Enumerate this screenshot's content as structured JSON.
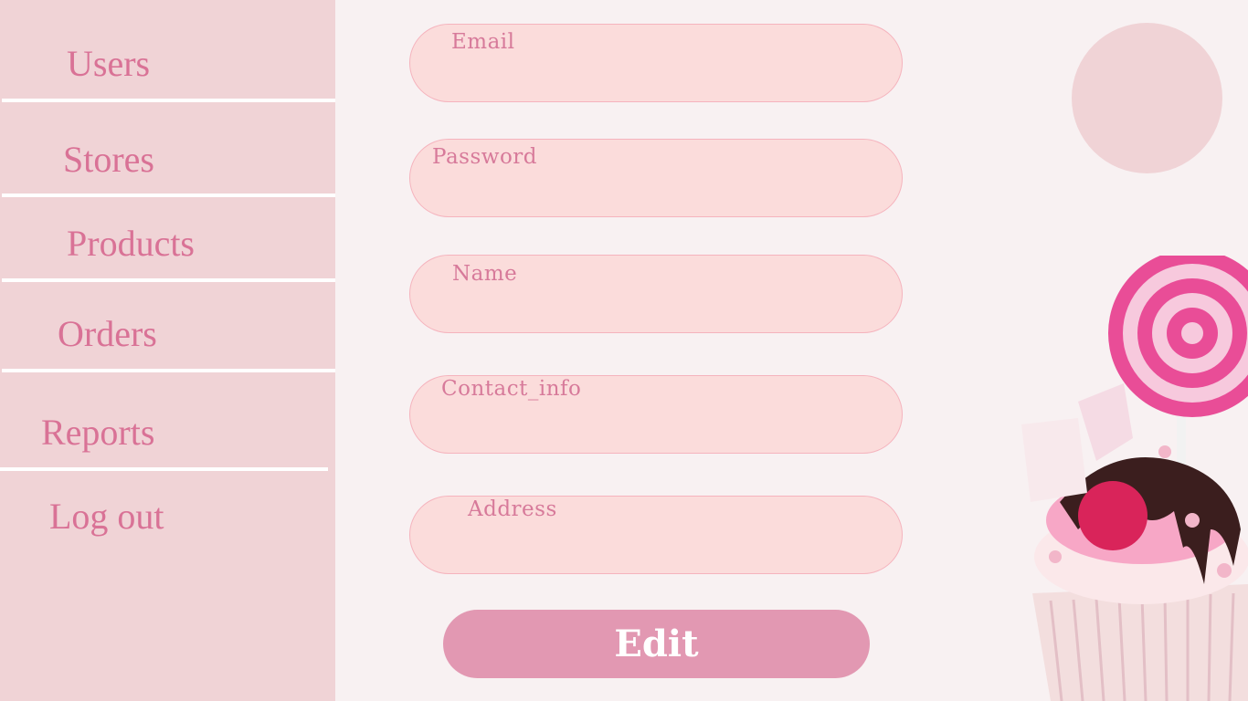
{
  "sidebar": {
    "items": [
      {
        "label": "Users"
      },
      {
        "label": "Stores"
      },
      {
        "label": "Products"
      },
      {
        "label": "Orders"
      },
      {
        "label": "Reports"
      },
      {
        "label": "Log out"
      }
    ]
  },
  "form": {
    "fields": [
      {
        "label": "Email",
        "value": ""
      },
      {
        "label": "Password",
        "value": ""
      },
      {
        "label": "Name",
        "value": ""
      },
      {
        "label": "Contact_info",
        "value": ""
      },
      {
        "label": "Address",
        "value": ""
      }
    ],
    "submit_label": "Edit"
  },
  "colors": {
    "sidebar_bg": "#f0d3d6",
    "nav_text": "#d97296",
    "field_bg": "#fbdcdb",
    "field_border": "#f5b3bd",
    "button_bg": "#e298b2",
    "page_bg": "#f8f1f2"
  },
  "decoration": {
    "icon": "cupcake-lollipop-icon"
  }
}
